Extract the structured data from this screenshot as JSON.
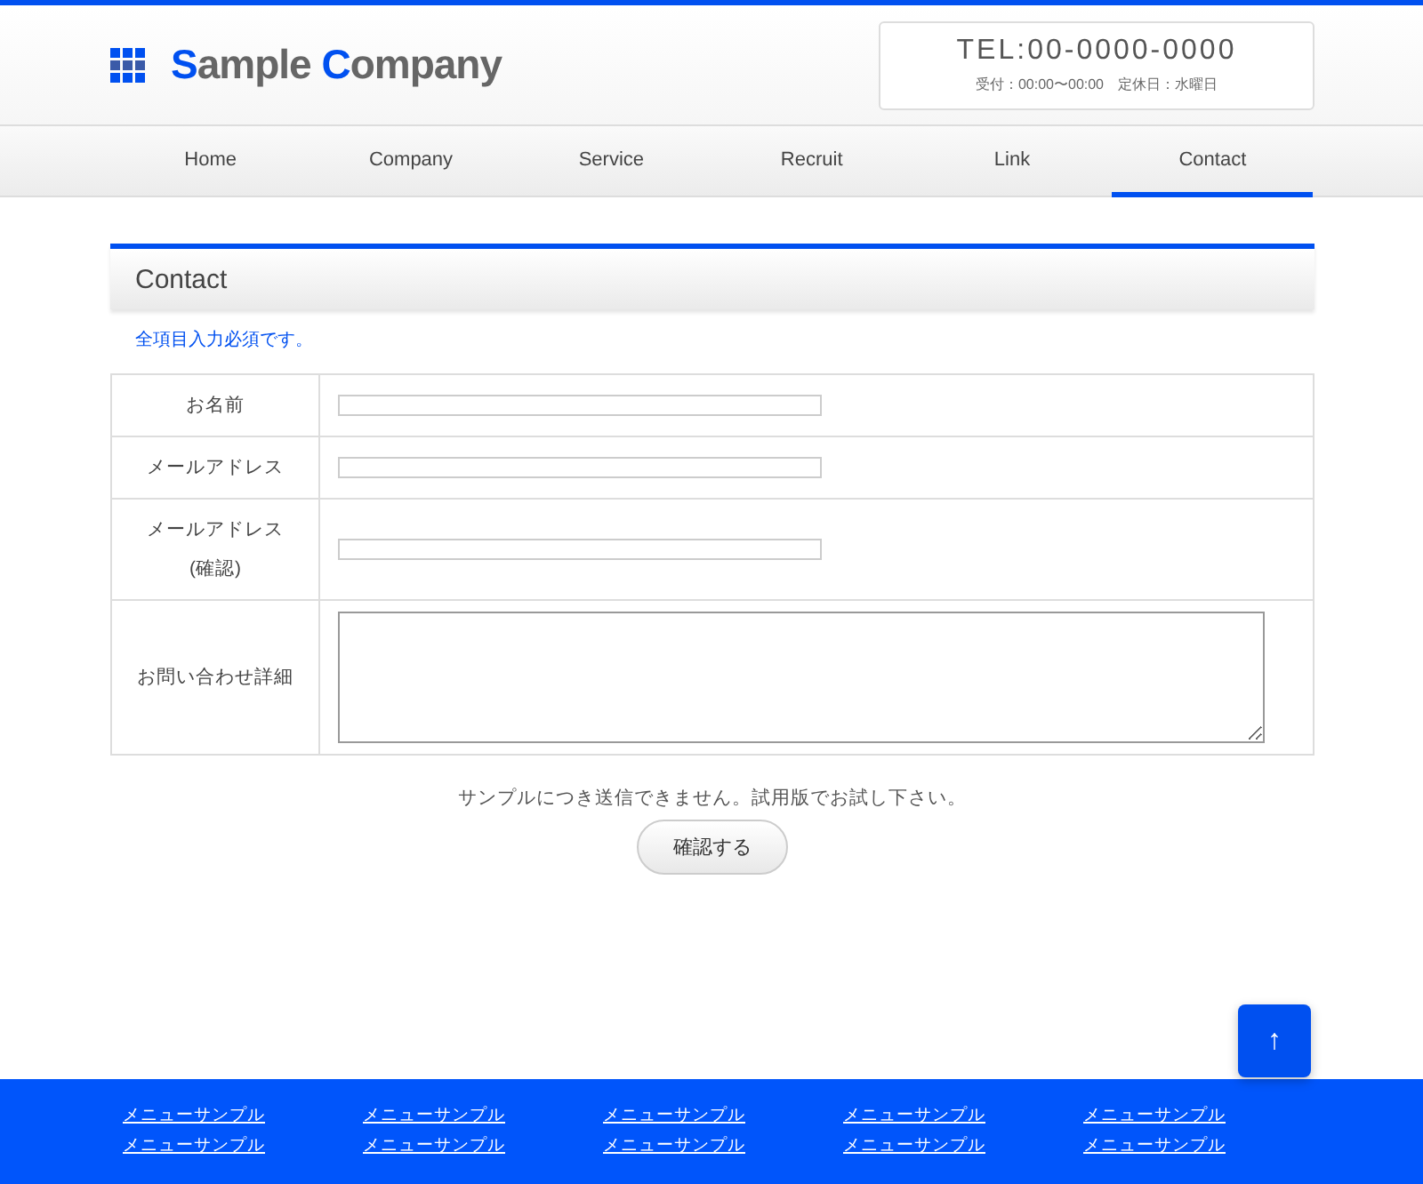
{
  "header": {
    "logo": [
      {
        "text": "S",
        "accent": true
      },
      {
        "text": "ample ",
        "accent": false
      },
      {
        "text": "C",
        "accent": true
      },
      {
        "text": "ompany",
        "accent": false
      }
    ],
    "phone": "TEL:00-0000-0000",
    "hours": "受付：00:00〜00:00　定休日：水曜日"
  },
  "nav": [
    {
      "label": "Home",
      "selected": false
    },
    {
      "label": "Company",
      "selected": false
    },
    {
      "label": "Service",
      "selected": false
    },
    {
      "label": "Recruit",
      "selected": false
    },
    {
      "label": "Link",
      "selected": false
    },
    {
      "label": "Contact",
      "selected": true
    }
  ],
  "section_title": "Contact",
  "required_note": "全項目入力必須です。",
  "form": [
    {
      "label": "お名前",
      "kind": "text"
    },
    {
      "label": "メールアドレス",
      "kind": "text"
    },
    {
      "label": "メールアドレス(確認)",
      "kind": "text"
    },
    {
      "label": "お問い合わせ詳細",
      "kind": "textarea"
    }
  ],
  "notice": "サンプルにつき送信できません。試用版でお試し下さい。",
  "confirm_button": "確認する",
  "scroll_top": "↑",
  "footer_links": [
    "メニューサンプル",
    "メニューサンプル",
    "メニューサンプル",
    "メニューサンプル",
    "メニューサンプル",
    "メニューサンプル",
    "メニューサンプル",
    "メニューサンプル",
    "メニューサンプル",
    "メニューサンプル"
  ]
}
